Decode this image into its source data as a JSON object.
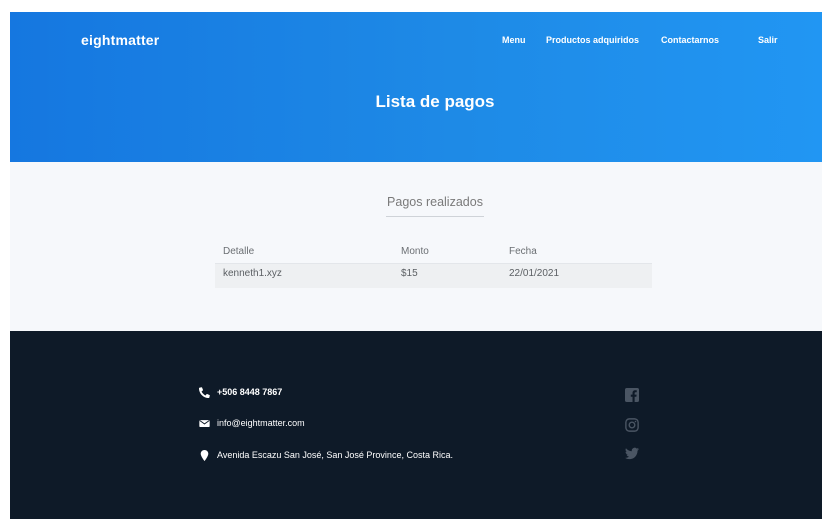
{
  "header": {
    "brand": "eightmatter",
    "nav": [
      "Menu",
      "Productos adquiridos",
      "Contactarnos",
      "Salir"
    ],
    "title": "Lista de pagos"
  },
  "payments": {
    "section_title": "Pagos realizados",
    "columns": [
      "Detalle",
      "Monto",
      "Fecha"
    ],
    "rows": [
      [
        "kenneth1.xyz",
        "$15",
        "22/01/2021"
      ]
    ]
  },
  "footer": {
    "phone": "+506 8448 7867",
    "email": "info@eightmatter.com",
    "address": "Avenida Escazu San José, San José Province, Costa Rica.",
    "social_icons": [
      "facebook-icon",
      "instagram-icon",
      "twitter-icon"
    ],
    "colors": {
      "background": "#0e1a28",
      "icon": "#ffffff",
      "social": "#4a5563"
    }
  },
  "theme": {
    "hero_gradient_start": "#1577e0",
    "hero_gradient_end": "#2196f3",
    "content_background": "#f6f8fb"
  }
}
